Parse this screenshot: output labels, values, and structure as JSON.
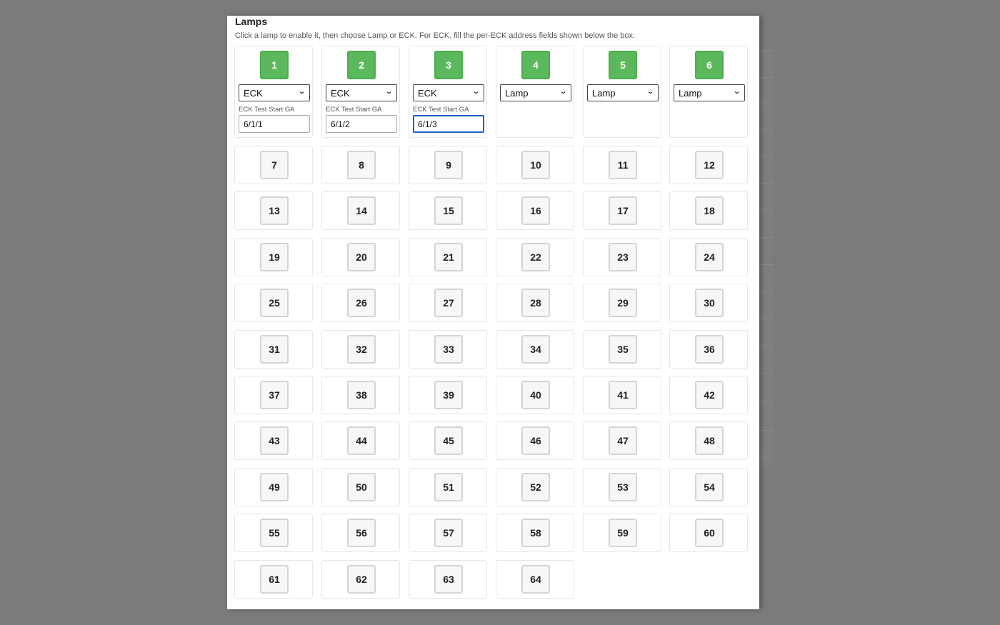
{
  "dialog": {
    "title": "Lamps",
    "hint": "Click a lamp to enable it, then choose Lamp or ECK. For ECK, fill the per-ECK address fields shown below the box."
  },
  "colors": {
    "enabled": "#5cb85c",
    "disabled": "#f7f7f7",
    "focus": "#1a5fc7"
  },
  "config_lamps": [
    {
      "number": "1",
      "enabled": true,
      "mode": "ECK",
      "ga_label": "ECK Test Start GA",
      "ga_value": "6/1/1"
    },
    {
      "number": "2",
      "enabled": true,
      "mode": "ECK",
      "ga_label": "ECK Test Start GA",
      "ga_value": "6/1/2"
    },
    {
      "number": "3",
      "enabled": true,
      "mode": "ECK",
      "ga_label": "ECK Test Start GA",
      "ga_value": "6/1/3"
    },
    {
      "number": "4",
      "enabled": true,
      "mode": "Lamp"
    },
    {
      "number": "5",
      "enabled": true,
      "mode": "Lamp"
    },
    {
      "number": "6",
      "enabled": true,
      "mode": "Lamp"
    }
  ],
  "other_lamps": [
    "7",
    "8",
    "9",
    "10",
    "11",
    "12",
    "13",
    "14",
    "15",
    "16",
    "17",
    "18",
    "19",
    "20",
    "21",
    "22",
    "23",
    "24",
    "25",
    "26",
    "27",
    "28",
    "29",
    "30",
    "31",
    "32",
    "33",
    "34",
    "35",
    "36",
    "37",
    "38",
    "39",
    "40",
    "41",
    "42",
    "43",
    "44",
    "45",
    "46",
    "47",
    "48",
    "49",
    "50",
    "51",
    "52",
    "53",
    "54",
    "55",
    "56",
    "57",
    "58",
    "59",
    "60",
    "61",
    "62",
    "63",
    "64"
  ]
}
